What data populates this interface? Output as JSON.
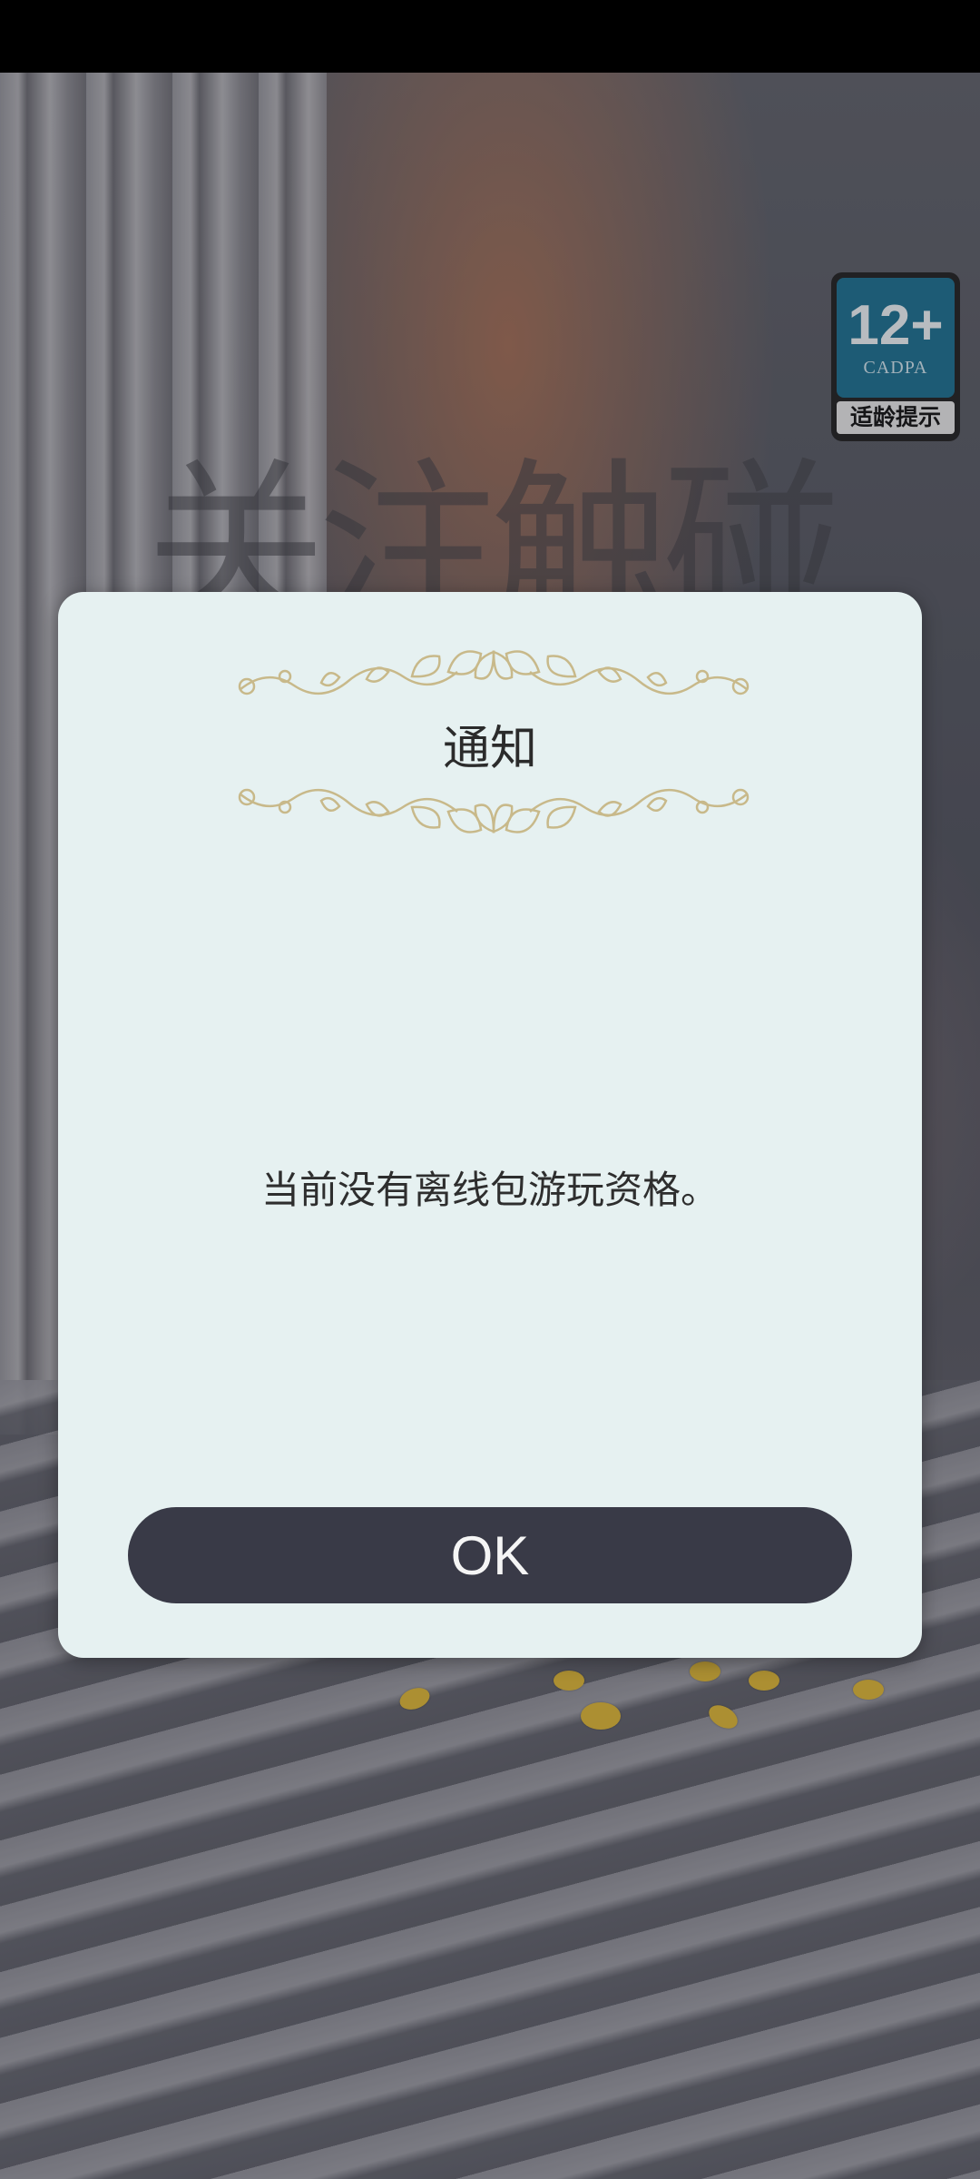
{
  "background": {
    "title_text": "关注触碰"
  },
  "age_rating": {
    "number": "12+",
    "org": "CADPA",
    "label": "适龄提示"
  },
  "dialog": {
    "title": "通知",
    "message": "当前没有离线包游玩资格。",
    "ok_label": "OK"
  },
  "colors": {
    "dialog_bg": "#e6f1f1",
    "button_bg": "#393a47",
    "ornament": "#c8b98a"
  }
}
